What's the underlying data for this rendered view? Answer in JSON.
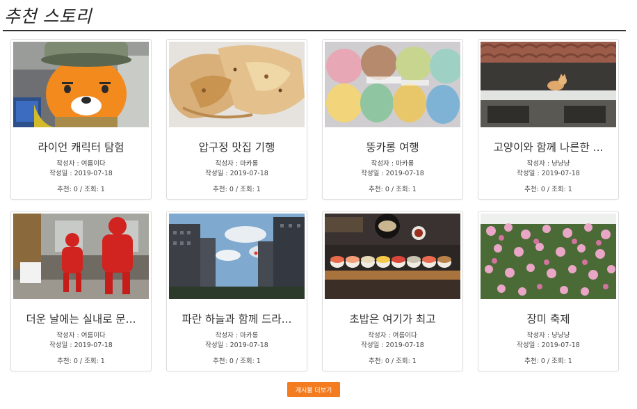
{
  "page": {
    "title": "추천 스토리"
  },
  "labels": {
    "author_prefix": "작성자 : ",
    "date_prefix": "작성일 : ",
    "likes_prefix": "추천: ",
    "views_prefix": " / 조회: "
  },
  "cards": [
    {
      "title": "라이언 캐릭터 탐험",
      "author": "작성자 : 여름이다",
      "date": "작성일 : 2019-07-18",
      "stats": "추천: 0 / 조회: 1",
      "image": "ryan-character-photo"
    },
    {
      "title": "압구정 맛집 기행",
      "author": "작성자 : 마카롱",
      "date": "작성일 : 2019-07-18",
      "stats": "추천: 0 / 조회: 1",
      "image": "pastry-food-photo"
    },
    {
      "title": "뚱카롱 여행",
      "author": "작성자 : 마카롱",
      "date": "작성일 : 2019-07-18",
      "stats": "추천: 0 / 조회: 1",
      "image": "macaron-packages-photo"
    },
    {
      "title": "고양이와 함께 나른한 ...",
      "author": "작성자 : 냥냥냥",
      "date": "작성일 : 2019-07-18",
      "stats": "추천: 0 / 조회: 1",
      "image": "cat-on-roof-photo"
    },
    {
      "title": "더운 날에는 실내로 문...",
      "author": "작성자 : 여름이다",
      "date": "작성일 : 2019-07-18",
      "stats": "추천: 0 / 조회: 1",
      "image": "red-statues-photo"
    },
    {
      "title": "파란 하늘과 함께 드라...",
      "author": "작성자 : 마카롱",
      "date": "작성일 : 2019-07-18",
      "stats": "추천: 0 / 조회: 1",
      "image": "city-sky-photo"
    },
    {
      "title": "초밥은 여기가 최고",
      "author": "작성자 : 여름이다",
      "date": "작성일 : 2019-07-18",
      "stats": "추천: 0 / 조회: 1",
      "image": "sushi-platter-photo"
    },
    {
      "title": "장미 축제",
      "author": "작성자 : 냥냥냥",
      "date": "작성일 : 2019-07-18",
      "stats": "추천: 0 / 조회: 1",
      "image": "rose-festival-photo"
    }
  ],
  "more_button": {
    "label": "게시물 더보기",
    "color": "#f47c20"
  }
}
